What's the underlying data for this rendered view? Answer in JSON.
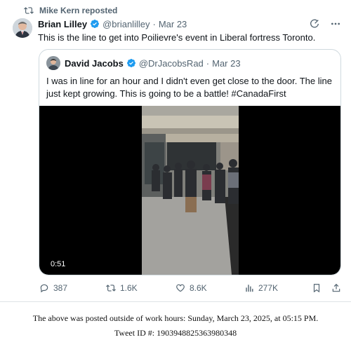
{
  "repost": {
    "label": "Mike Kern reposted"
  },
  "tweet": {
    "author_name": "Brian Lilley",
    "handle": "@brianlilley",
    "separator": "·",
    "date": "Mar 23",
    "text": "This is the line to get into Poilievre's event in Liberal fortress Toronto."
  },
  "quote": {
    "author_name": "David Jacobs",
    "handle": "@DrJacobsRad",
    "separator": "·",
    "date": "Mar 23",
    "text": "I was in line for an hour and I didn't even get close to the door. The line just kept growing. This is going to be a battle! #CanadaFirst",
    "video_duration": "0:51"
  },
  "actions": {
    "replies": "387",
    "reposts": "1.6K",
    "likes": "8.6K",
    "views": "277K"
  },
  "icons": {
    "repost": "repost-icon",
    "verified": "verified-badge-icon",
    "grok": "grok-icon",
    "more": "more-icon",
    "reply": "reply-icon",
    "like": "heart-icon",
    "views": "views-icon",
    "bookmark": "bookmark-icon",
    "share": "share-icon"
  },
  "colors": {
    "verified": "#1d9bf0",
    "muted": "#536471",
    "border": "#cfd9de"
  },
  "footer": {
    "line1": "The above was posted outside of work hours: Sunday, March 23, 2025, at 05:15 PM.",
    "line2": "Tweet ID #: 1903948825363980348"
  }
}
